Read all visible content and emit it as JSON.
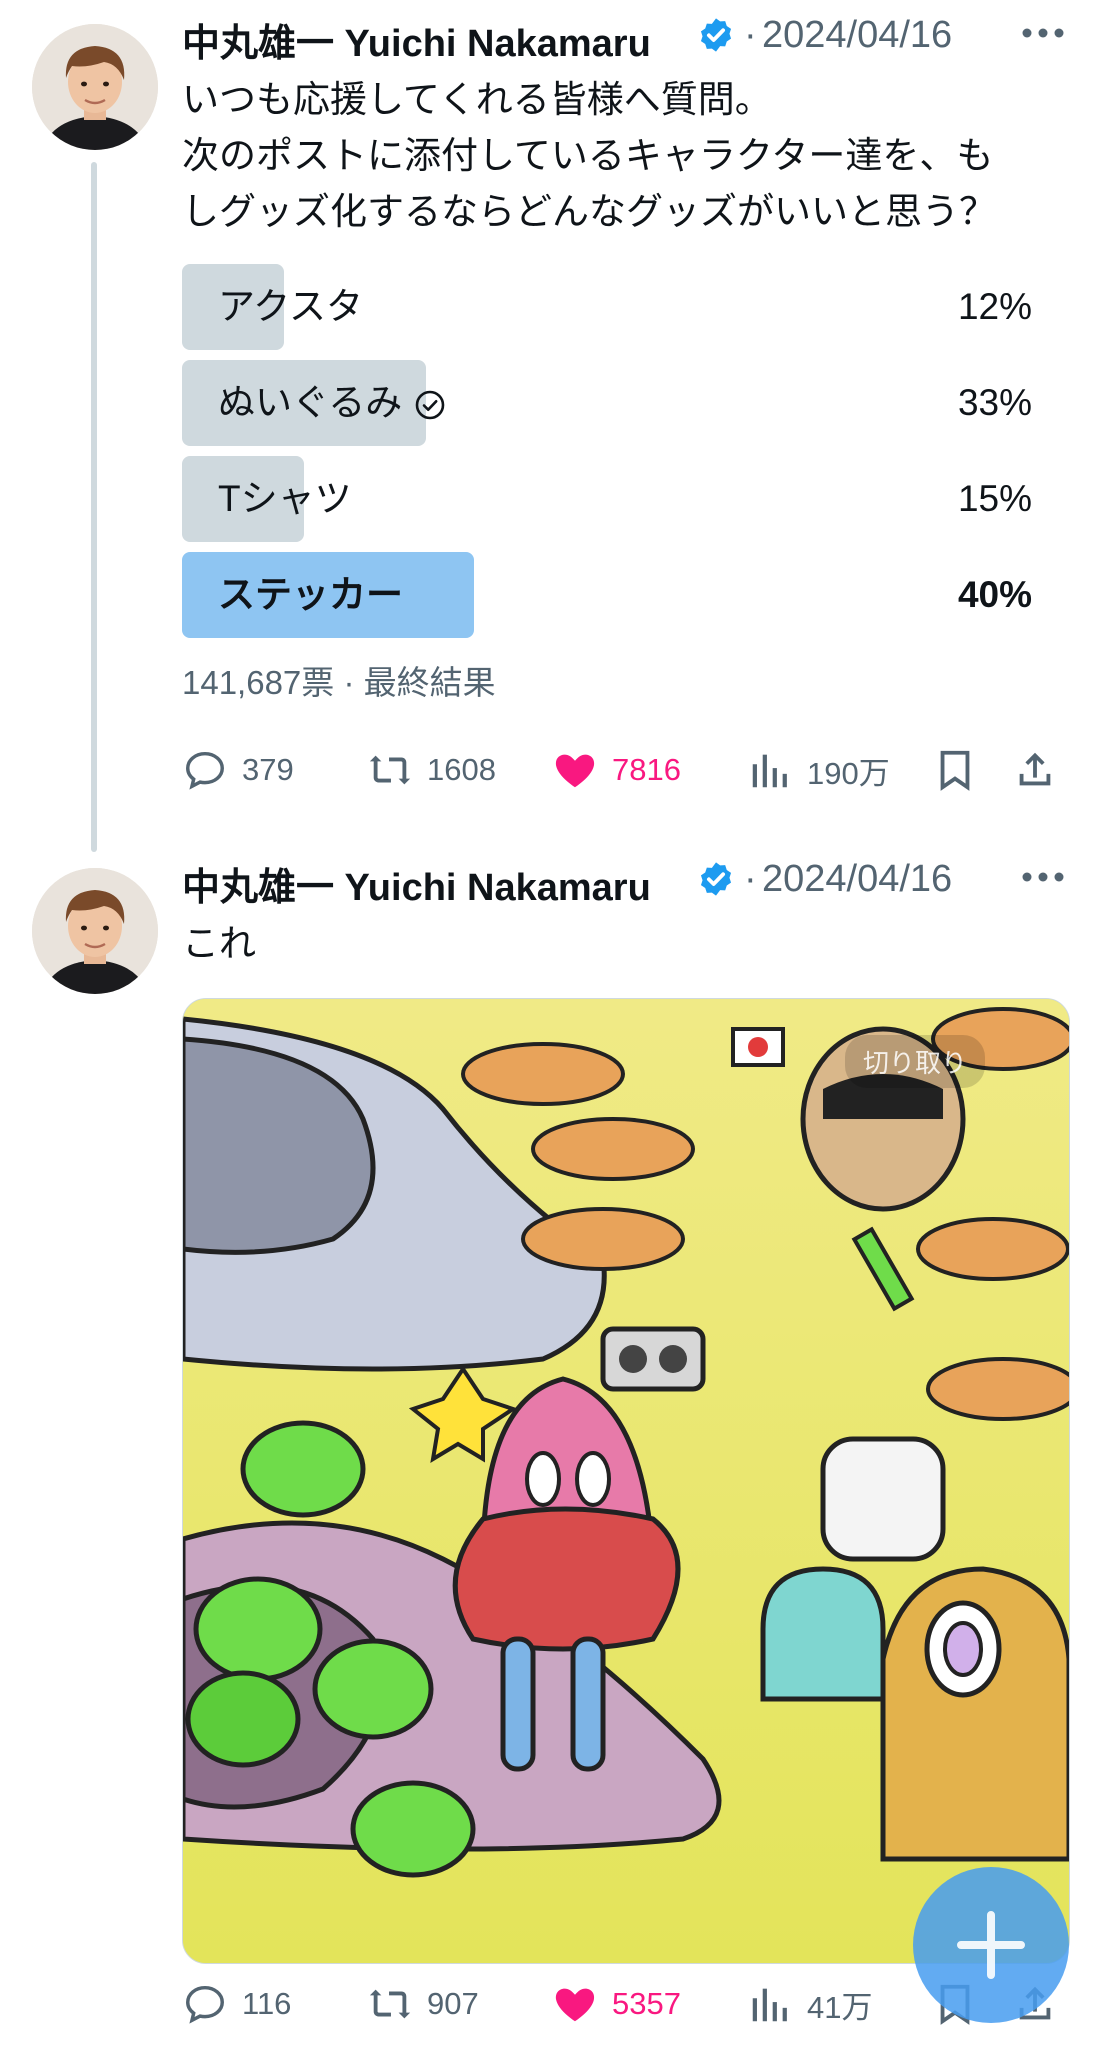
{
  "posts": [
    {
      "author": "中丸雄一 Yuichi Nakamaru",
      "separator": "·",
      "date": "2024/04/16",
      "text_lines": [
        "いつも応援してくれる皆様へ質問。",
        "次のポストに添付しているキャラクター達を、も",
        "しグッズ化するならどんなグッズがいいと思う？"
      ],
      "poll": {
        "options": [
          {
            "label": "アクスタ",
            "percent_text": "12%",
            "share": 0.12,
            "winner": false,
            "voted": false
          },
          {
            "label": "ぬいぐるみ",
            "percent_text": "33%",
            "share": 0.33,
            "winner": false,
            "voted": true
          },
          {
            "label": "Tシャツ",
            "percent_text": "15%",
            "share": 0.15,
            "winner": false,
            "voted": false
          },
          {
            "label": "ステッカー",
            "percent_text": "40%",
            "share": 0.4,
            "winner": true,
            "voted": false
          }
        ],
        "votes": "141,687票",
        "status": "最終結果"
      },
      "actions": {
        "replies": "379",
        "reposts": "1608",
        "likes": "7816",
        "views": "190万"
      }
    },
    {
      "author": "中丸雄一 Yuichi Nakamaru",
      "separator": "·",
      "date": "2024/04/16",
      "text": "これ",
      "media_overlay_label": "切り取り",
      "actions": {
        "replies": "116",
        "reposts": "907",
        "likes": "5357",
        "views": "41万"
      }
    }
  ],
  "colors": {
    "verified": "#1d9bf0",
    "like": "#f91880",
    "poll_bar": "#cfd9de",
    "poll_winner": "#8ec5f2",
    "muted_text": "#536471"
  },
  "icons": {
    "reply": "speech-bubble-icon",
    "repost": "repost-arrows-icon",
    "like": "heart-filled-icon",
    "views": "bar-chart-icon",
    "bookmark": "bookmark-icon",
    "share": "share-upload-icon",
    "verified": "verified-badge-icon",
    "more": "more-dots-icon"
  }
}
